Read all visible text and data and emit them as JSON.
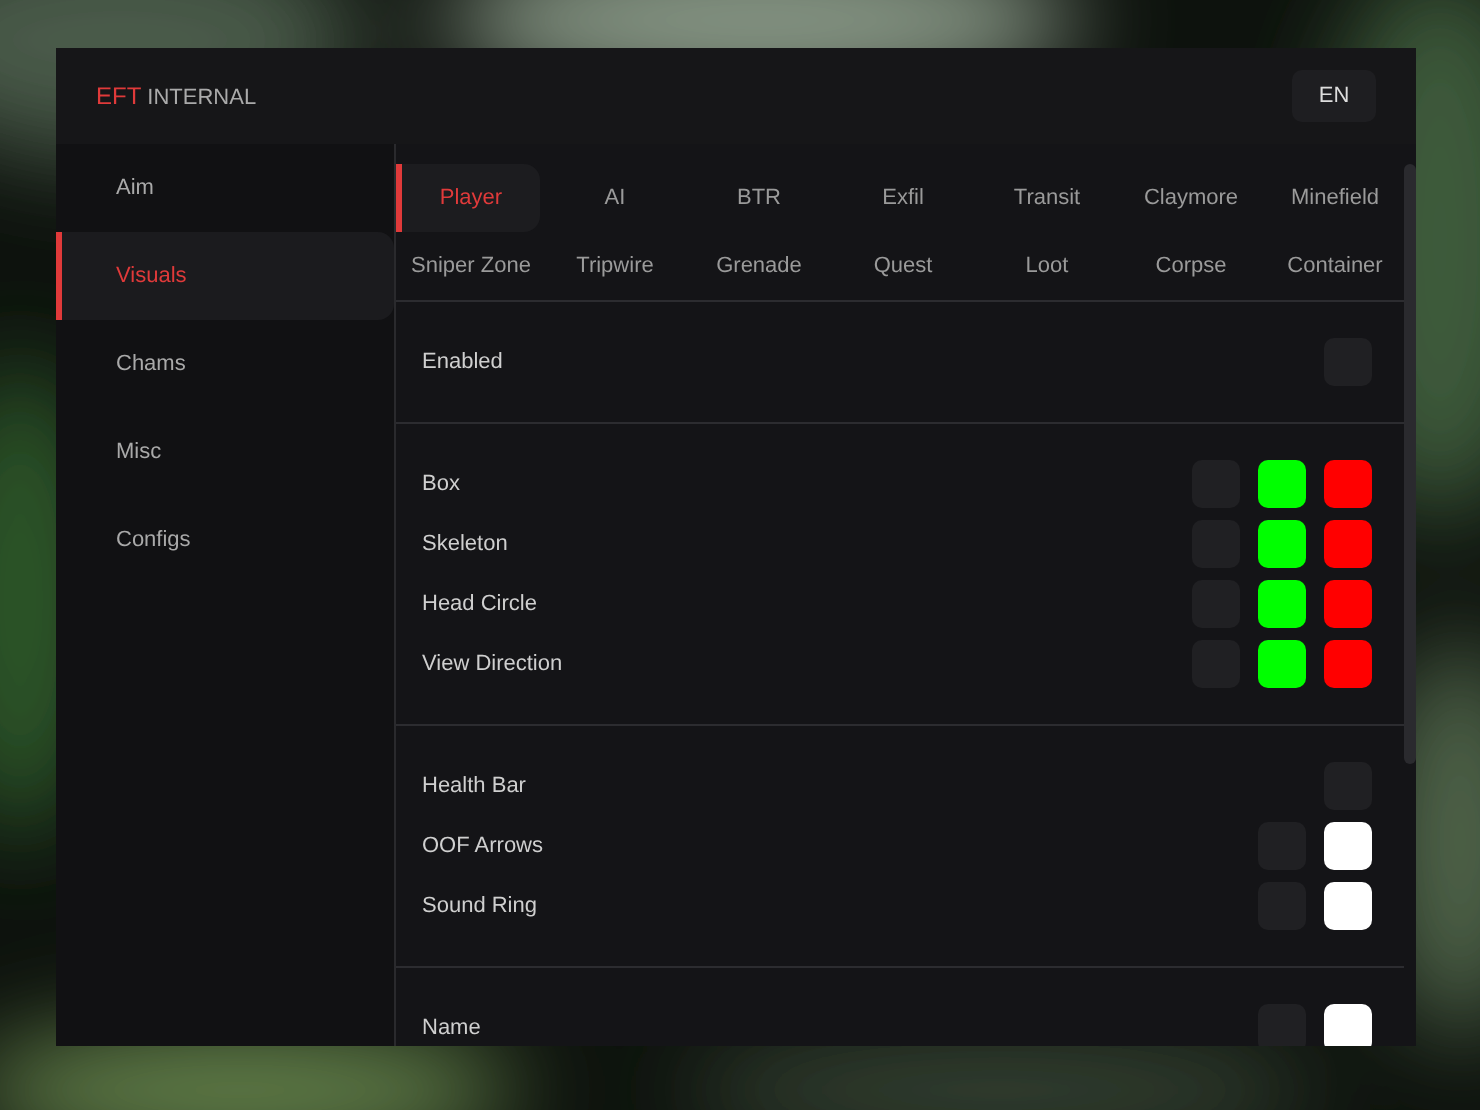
{
  "header": {
    "brand": "EFT",
    "title": "INTERNAL",
    "language": "EN"
  },
  "sidebar": {
    "items": [
      {
        "label": "Aim",
        "selected": false
      },
      {
        "label": "Visuals",
        "selected": true
      },
      {
        "label": "Chams",
        "selected": false
      },
      {
        "label": "Misc",
        "selected": false
      },
      {
        "label": "Configs",
        "selected": false
      }
    ]
  },
  "tabs": [
    {
      "label": "Player",
      "selected": true
    },
    {
      "label": "AI",
      "selected": false
    },
    {
      "label": "BTR",
      "selected": false
    },
    {
      "label": "Exfil",
      "selected": false
    },
    {
      "label": "Transit",
      "selected": false
    },
    {
      "label": "Claymore",
      "selected": false
    },
    {
      "label": "Minefield",
      "selected": false
    },
    {
      "label": "Sniper Zone",
      "selected": false
    },
    {
      "label": "Tripwire",
      "selected": false
    },
    {
      "label": "Grenade",
      "selected": false
    },
    {
      "label": "Quest",
      "selected": false
    },
    {
      "label": "Loot",
      "selected": false
    },
    {
      "label": "Corpse",
      "selected": false
    },
    {
      "label": "Container",
      "selected": false
    }
  ],
  "sections": [
    {
      "rows": [
        {
          "label": "Enabled",
          "checked": false,
          "swatches": []
        }
      ]
    },
    {
      "rows": [
        {
          "label": "Box",
          "checked": false,
          "swatches": [
            {
              "color": "#00ff00"
            },
            {
              "color": "#ff0000"
            }
          ]
        },
        {
          "label": "Skeleton",
          "checked": false,
          "swatches": [
            {
              "color": "#00ff00"
            },
            {
              "color": "#ff0000"
            }
          ]
        },
        {
          "label": "Head Circle",
          "checked": false,
          "swatches": [
            {
              "color": "#00ff00"
            },
            {
              "color": "#ff0000"
            }
          ]
        },
        {
          "label": "View Direction",
          "checked": false,
          "swatches": [
            {
              "color": "#00ff00"
            },
            {
              "color": "#ff0000"
            }
          ]
        }
      ]
    },
    {
      "rows": [
        {
          "label": "Health Bar",
          "checked": false,
          "swatches": []
        },
        {
          "label": "OOF Arrows",
          "checked": false,
          "swatches": [
            {
              "color": "#ffffff"
            }
          ]
        },
        {
          "label": "Sound Ring",
          "checked": false,
          "swatches": [
            {
              "color": "#ffffff"
            }
          ]
        }
      ]
    },
    {
      "rows": [
        {
          "label": "Name",
          "checked": false,
          "swatches": [
            {
              "color": "#ffffff"
            }
          ]
        }
      ]
    }
  ]
}
